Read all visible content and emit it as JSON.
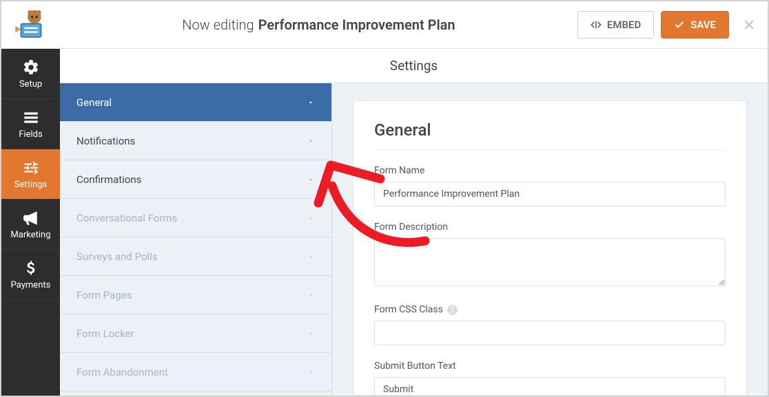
{
  "header": {
    "editing_prefix": "Now editing",
    "form_title": "Performance Improvement Plan",
    "embed_label": "EMBED",
    "save_label": "SAVE"
  },
  "vnav": {
    "items": [
      {
        "key": "setup",
        "label": "Setup"
      },
      {
        "key": "fields",
        "label": "Fields"
      },
      {
        "key": "settings",
        "label": "Settings"
      },
      {
        "key": "marketing",
        "label": "Marketing"
      },
      {
        "key": "payments",
        "label": "Payments"
      }
    ],
    "active": "settings"
  },
  "content": {
    "title": "Settings"
  },
  "settings_panel": {
    "items": [
      {
        "label": "General",
        "state": "active",
        "chevron": "down"
      },
      {
        "label": "Notifications",
        "state": "normal",
        "chevron": "right"
      },
      {
        "label": "Confirmations",
        "state": "normal",
        "chevron": "right"
      },
      {
        "label": "Conversational Forms",
        "state": "disabled",
        "chevron": "right"
      },
      {
        "label": "Surveys and Polls",
        "state": "disabled",
        "chevron": "right"
      },
      {
        "label": "Form Pages",
        "state": "disabled",
        "chevron": "right"
      },
      {
        "label": "Form Locker",
        "state": "disabled",
        "chevron": "right"
      },
      {
        "label": "Form Abandonment",
        "state": "disabled",
        "chevron": "right"
      }
    ]
  },
  "general_panel": {
    "heading": "General",
    "fields": {
      "form_name": {
        "label": "Form Name",
        "value": "Performance Improvement Plan"
      },
      "form_description": {
        "label": "Form Description",
        "value": ""
      },
      "form_css_class": {
        "label": "Form CSS Class",
        "value": "",
        "help": true
      },
      "submit_button": {
        "label": "Submit Button Text",
        "value": "Submit"
      }
    }
  },
  "colors": {
    "accent_orange": "#e27730",
    "accent_blue": "#3b6ca8",
    "annotation_red": "#ed1c24"
  }
}
